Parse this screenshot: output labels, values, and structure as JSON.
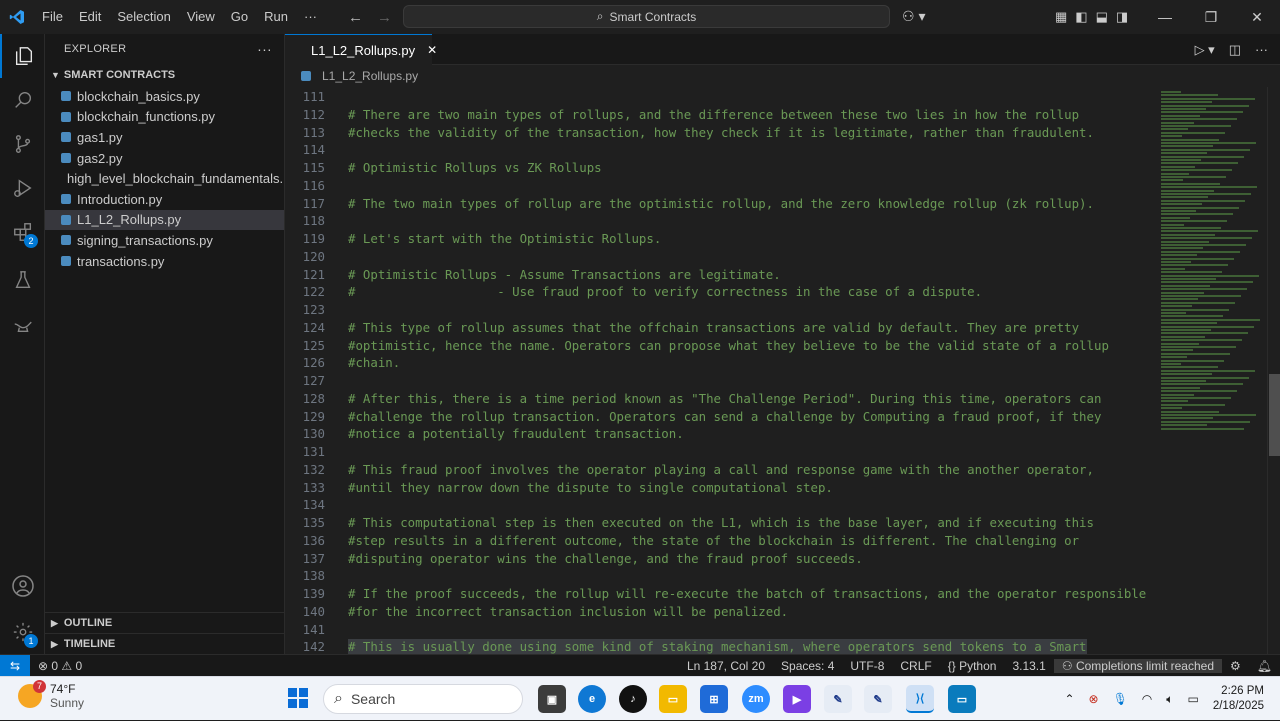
{
  "menu": [
    "File",
    "Edit",
    "Selection",
    "View",
    "Go",
    "Run",
    "···"
  ],
  "search": {
    "label": "Smart Contracts"
  },
  "explorer": {
    "title": "EXPLORER",
    "more": "···",
    "folder": "SMART CONTRACTS",
    "files": [
      "blockchain_basics.py",
      "blockchain_functions.py",
      "gas1.py",
      "gas2.py",
      "high_level_blockchain_fundamentals....",
      "Introduction.py",
      "L1_L2_Rollups.py",
      "signing_transactions.py",
      "transactions.py"
    ],
    "selected_index": 6,
    "outline": "OUTLINE",
    "timeline": "TIMELINE"
  },
  "activity": {
    "extensions_badge": "2",
    "settings_badge": "1"
  },
  "tab": {
    "label": "L1_L2_Rollups.py",
    "close": "✕"
  },
  "breadcrumb": {
    "file": "L1_L2_Rollups.py"
  },
  "editor": {
    "lines": [
      {
        "n": "111",
        "t": ""
      },
      {
        "n": "112",
        "t": "# There are two main types of rollups, and the difference between these two lies in how the rollup"
      },
      {
        "n": "113",
        "t": "#checks the validity of the transaction, how they check if it is legitimate, rather than fraudulent."
      },
      {
        "n": "114",
        "t": ""
      },
      {
        "n": "115",
        "t": "# Optimistic Rollups vs ZK Rollups"
      },
      {
        "n": "116",
        "t": ""
      },
      {
        "n": "117",
        "t": "# The two main types of rollup are the optimistic rollup, and the zero knowledge rollup (zk rollup)."
      },
      {
        "n": "118",
        "t": ""
      },
      {
        "n": "119",
        "t": "# Let's start with the Optimistic Rollups."
      },
      {
        "n": "120",
        "t": ""
      },
      {
        "n": "121",
        "t": "# Optimistic Rollups - Assume Transactions are legitimate."
      },
      {
        "n": "122",
        "t": "#                   - Use fraud proof to verify correctness in the case of a dispute."
      },
      {
        "n": "123",
        "t": ""
      },
      {
        "n": "124",
        "t": "# This type of rollup assumes that the offchain transactions are valid by default. They are pretty"
      },
      {
        "n": "125",
        "t": "#optimistic, hence the name. Operators can propose what they believe to be the valid state of a rollup"
      },
      {
        "n": "126",
        "t": "#chain."
      },
      {
        "n": "127",
        "t": ""
      },
      {
        "n": "128",
        "t": "# After this, there is a time period known as \"The Challenge Period\". During this time, operators can"
      },
      {
        "n": "129",
        "t": "#challenge the rollup transaction. Operators can send a challenge by Computing a fraud proof, if they"
      },
      {
        "n": "130",
        "t": "#notice a potentially fraudulent transaction."
      },
      {
        "n": "131",
        "t": ""
      },
      {
        "n": "132",
        "t": "# This fraud proof involves the operator playing a call and response game with the another operator,"
      },
      {
        "n": "133",
        "t": "#until they narrow down the dispute to single computational step."
      },
      {
        "n": "134",
        "t": ""
      },
      {
        "n": "135",
        "t": "# This computational step is then executed on the L1, which is the base layer, and if executing this"
      },
      {
        "n": "136",
        "t": "#step results in a different outcome, the state of the blockchain is different. The challenging or"
      },
      {
        "n": "137",
        "t": "#disputing operator wins the challenge, and the fraud proof succeeds."
      },
      {
        "n": "138",
        "t": ""
      },
      {
        "n": "139",
        "t": "# If the proof succeeds, the rollup will re-execute the batch of transactions, and the operator responsible"
      },
      {
        "n": "140",
        "t": "#for the incorrect transaction inclusion will be penalized."
      },
      {
        "n": "141",
        "t": ""
      },
      {
        "n": "142",
        "t": "# This is usually done using some kind of staking mechanism, where operators send tokens to a Smart"
      }
    ]
  },
  "status": {
    "errors": "⊗ 0 ⚠ 0",
    "position": "Ln 187, Col 20",
    "spaces": "Spaces: 4",
    "encoding": "UTF-8",
    "eol": "CRLF",
    "language": "Python",
    "version": "3.13.1",
    "copilot": "Completions limit reached"
  },
  "taskbar": {
    "temp": "74°F",
    "condition": "Sunny",
    "weather_badge": "7",
    "search": "Search",
    "time": "2:26 PM",
    "date": "2/18/2025"
  },
  "colors": {
    "accent": "#0078d4",
    "comment": "#6a9955",
    "editor_bg": "#1f1f1f"
  }
}
